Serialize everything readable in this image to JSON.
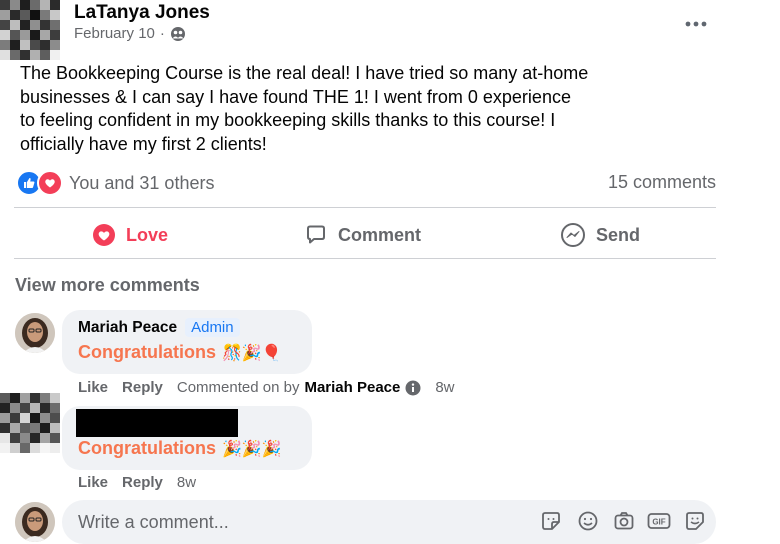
{
  "post": {
    "author": "LaTanya Jones",
    "date": "February 10",
    "separator": "·",
    "more_icon": "more-horizontal-icon",
    "body": "The Bookkeeping Course is the real deal! I have tried so many at-home businesses & I can say I have found THE 1! I went from 0 experience to feeling confident in my bookkeeping skills thanks to this course! I officially have my first 2 clients!",
    "reactions_text": "You and 31 others",
    "comments_count": "15 comments"
  },
  "actions": {
    "love": "Love",
    "comment": "Comment",
    "send": "Send"
  },
  "comments_section": {
    "view_more": "View more comments",
    "comments": [
      {
        "name": "Mariah Peace",
        "badge": "Admin",
        "text": "Congratulations",
        "emojis": "🎊🎉🎈",
        "like": "Like",
        "reply": "Reply",
        "commented_on_by": "Commented on by",
        "commented_by_name": "Mariah Peace",
        "time": "8w"
      },
      {
        "text": "Congratulations",
        "emojis": "🎉🎉🎉",
        "like": "Like",
        "reply": "Reply",
        "time": "8w"
      }
    ]
  },
  "composer": {
    "placeholder": "Write a comment...",
    "tools": [
      "sticker-icon",
      "emoji-icon",
      "camera-icon",
      "gif-icon",
      "avatar-sticker-icon"
    ],
    "gif_label": "GIF"
  },
  "colors": {
    "accent_blue": "#1877f2",
    "love_red": "#f33e58",
    "congrats_orange": "#f6764f",
    "muted_text": "#65676b"
  }
}
